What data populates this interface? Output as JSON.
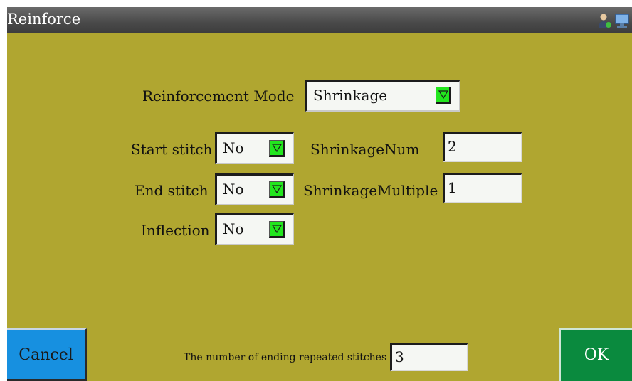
{
  "window": {
    "title": "Reinforce"
  },
  "header_icons": [
    "user-icon",
    "monitor-icon"
  ],
  "form": {
    "reinforcement_mode": {
      "label": "Reinforcement Mode",
      "value": "Shrinkage"
    },
    "start_stitch": {
      "label": "Start stitch",
      "value": "No"
    },
    "end_stitch": {
      "label": "End stitch",
      "value": "No"
    },
    "inflection": {
      "label": "Inflection",
      "value": "No"
    },
    "shrinkage_num": {
      "label": "ShrinkageNum",
      "value": "2"
    },
    "shrinkage_multiple": {
      "label": "ShrinkageMultiple",
      "value": "1"
    }
  },
  "footer": {
    "cancel_label": "Cancel",
    "ok_label": "OK",
    "ending_repeats_label": "The number of ending repeated stitches",
    "ending_repeats_value": "3"
  },
  "colors": {
    "background": "#b0a630",
    "titlebar": "#4a4a4a",
    "dropdown_arrow": "#22e61e",
    "cancel": "#1790e0",
    "ok": "#0a8a3e"
  }
}
